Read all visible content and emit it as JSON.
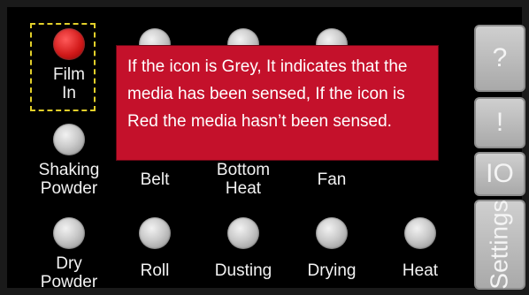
{
  "indicators_row1": [
    {
      "label": "Film\nIn",
      "state": "red"
    },
    {
      "label": "",
      "state": "grey"
    },
    {
      "label": "",
      "state": "grey"
    },
    {
      "label": "",
      "state": "grey"
    }
  ],
  "film_in_label": "Film\nIn",
  "row1_labels": [
    "Shaking\nPowder",
    "Belt",
    "Bottom\nHeat",
    "Fan"
  ],
  "row2_labels": [
    "Dry\nPowder",
    "Roll",
    "Dusting",
    "Drying",
    "Heat"
  ],
  "tooltip": {
    "text": "If the icon is Grey, It indicates that the media has been sensed, If the icon is Red the media hasn’t been sensed."
  },
  "side_buttons": {
    "help": "?",
    "alert": "!",
    "io": "IO",
    "settings": "Settings"
  },
  "colors": {
    "led_red": "#d21a1a",
    "led_grey": "#c9c9c9",
    "tooltip_bg": "#c4112b",
    "highlight": "#e2cf2a"
  }
}
